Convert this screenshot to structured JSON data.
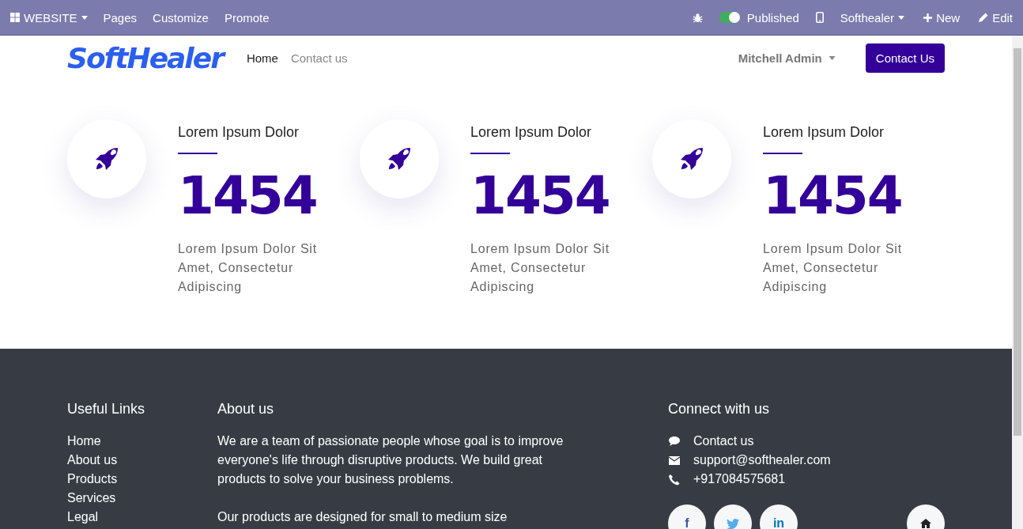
{
  "admin_bar": {
    "menu": {
      "label": "WEBSITE"
    },
    "items": [
      "Pages",
      "Customize",
      "Promote"
    ],
    "published": {
      "label": "Published",
      "on": true
    },
    "company": "Softhealer",
    "new": "New",
    "edit": "Edit"
  },
  "navbar": {
    "logo": "SoftHealer",
    "links": [
      {
        "label": "Home",
        "selected": true
      },
      {
        "label": "Contact us",
        "selected": false
      }
    ],
    "user": "Mitchell Admin",
    "cta": "Contact Us"
  },
  "stats": [
    {
      "title": "Lorem Ipsum Dolor",
      "value": "1454",
      "text": "Lorem Ipsum Dolor Sit Amet, Consectetur Adipiscing"
    },
    {
      "title": "Lorem Ipsum Dolor",
      "value": "1454",
      "text": "Lorem Ipsum Dolor Sit Amet, Consectetur Adipiscing"
    },
    {
      "title": "Lorem Ipsum Dolor",
      "value": "1454",
      "text": "Lorem Ipsum Dolor Sit Amet, Consectetur Adipiscing"
    }
  ],
  "footer": {
    "links_title": "Useful Links",
    "links": [
      "Home",
      "About us",
      "Products",
      "Services",
      "Legal"
    ],
    "about_title": "About us",
    "about": [
      "We are a team of passionate people whose goal is to improve everyone's life through disruptive products. We build great products to solve your business problems.",
      "Our products are designed for small to medium size"
    ],
    "connect_title": "Connect with us",
    "contacts": [
      {
        "kind": "chat",
        "text": "Contact us"
      },
      {
        "kind": "mail",
        "text": "support@softhealer.com"
      },
      {
        "kind": "phone",
        "text": "+917084575681"
      }
    ],
    "social": [
      {
        "kind": "letter",
        "text": "f",
        "color": "#3b5998"
      },
      {
        "kind": "bird",
        "color": "#55acee"
      },
      {
        "kind": "letter",
        "text": "in",
        "color": "#0077b5"
      }
    ]
  }
}
